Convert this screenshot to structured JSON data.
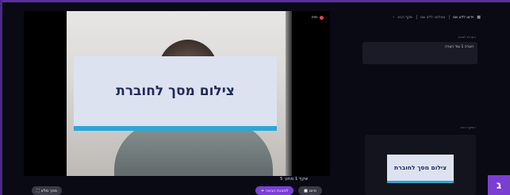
{
  "main": {
    "rec_label": "חיה",
    "overlay_title": "צילום מסך לחוברת",
    "slide_counter": "שקף 1 מתוך 5"
  },
  "controls": {
    "fullscreen_label": "מסך מלא",
    "next_label": "למצגת הבאה",
    "stop_label": "סיום"
  },
  "sidebar": {
    "header_item_1": "שקף הבא",
    "header_item_2": "מצלמה ללא שם",
    "header_item_3": "וידאו ללא שם",
    "notes_heading": "הערות למציג",
    "notes_text": "הערה 1 עוד הערה",
    "next_heading": "השקף הבא",
    "preview_title": "צילום מסך לחוברת"
  },
  "brand": {
    "logo_letter": "ג"
  },
  "colors": {
    "accent": "#7c3fd6",
    "card_bg": "#dde2f0",
    "card_border": "#2aa7d8",
    "title_text": "#1f2a5c"
  }
}
